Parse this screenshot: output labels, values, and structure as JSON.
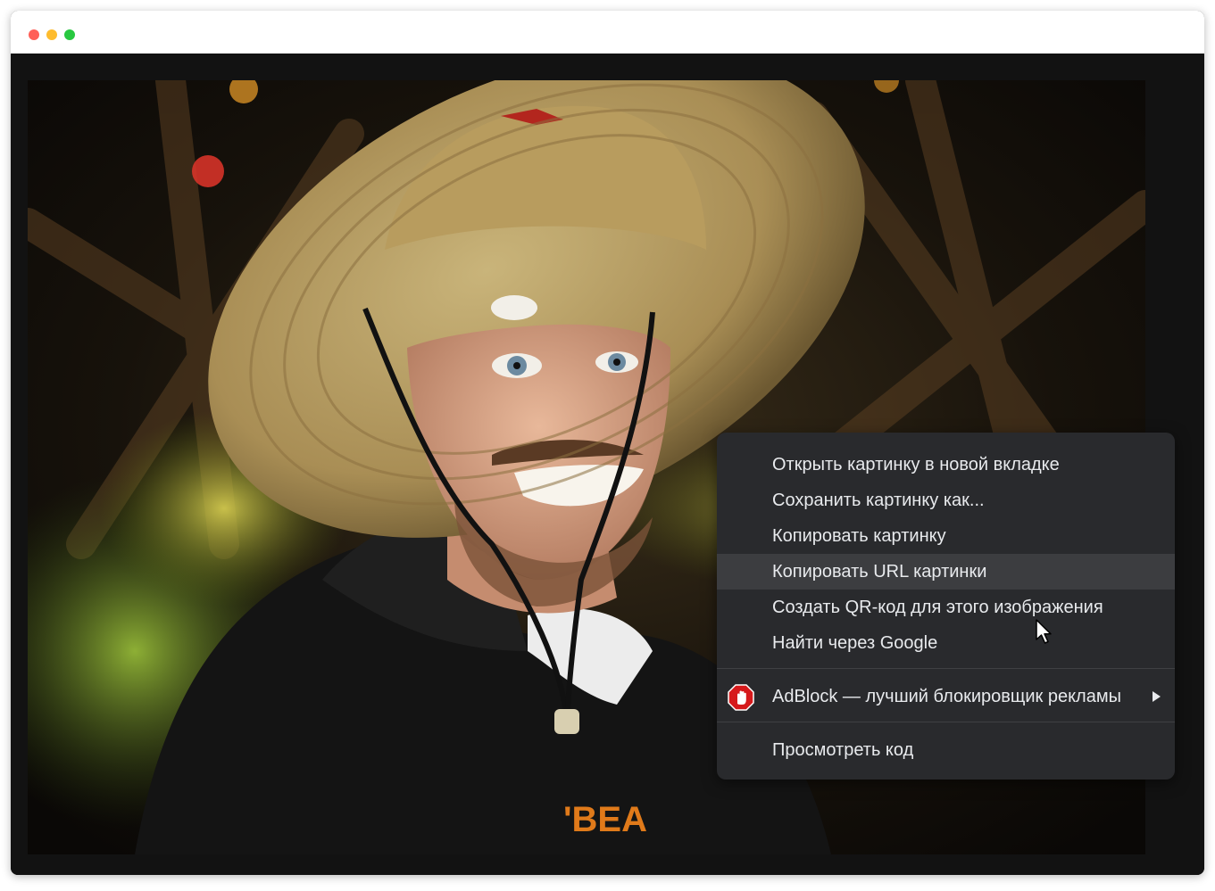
{
  "window": {
    "controls": [
      {
        "name": "close",
        "color": "#ff5f57"
      },
      {
        "name": "minimize",
        "color": "#febc2e"
      },
      {
        "name": "zoom",
        "color": "#28c840"
      }
    ]
  },
  "photo": {
    "shirt_text": "'BEA"
  },
  "context_menu": {
    "items": [
      {
        "label": "Открыть картинку в новой вкладке"
      },
      {
        "label": "Сохранить картинку как..."
      },
      {
        "label": "Копировать картинку"
      },
      {
        "label": "Копировать URL картинки",
        "hovered": true
      },
      {
        "label": "Создать QR-код для этого изображения"
      },
      {
        "label": "Найти через Google"
      }
    ],
    "extension_item": {
      "label": "AdBlock — лучший блокировщик рекламы",
      "icon": "adblock-hand-icon",
      "has_submenu": true
    },
    "devtools_item": {
      "label": "Просмотреть код"
    }
  }
}
